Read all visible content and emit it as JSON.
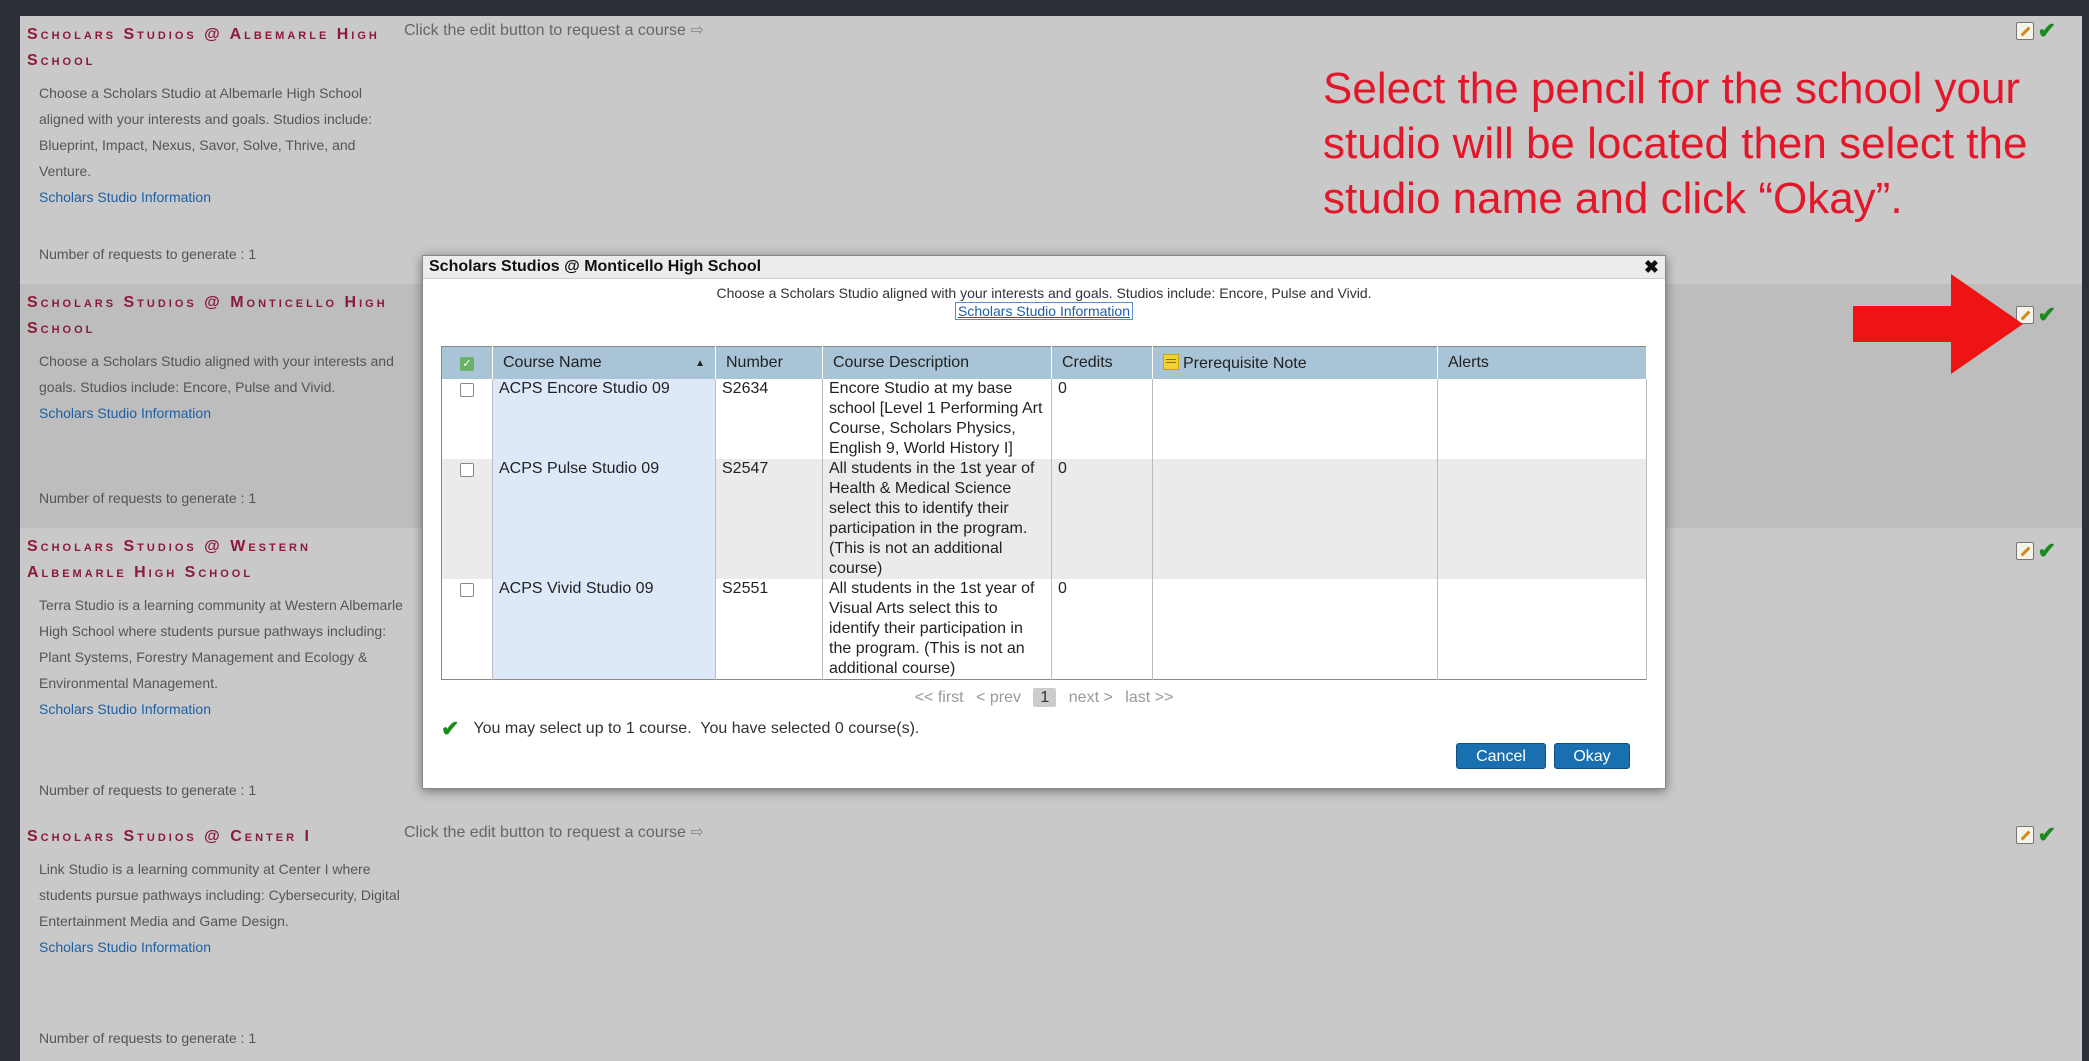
{
  "sections": [
    {
      "title": "Scholars Studios @ Albemarle High School",
      "description": "Choose a Scholars Studio at Albemarle High School aligned with your interests and goals. Studios include: Blueprint, Impact, Nexus, Savor, Solve, Thrive, and Venture.",
      "link": "Scholars Studio Information",
      "requests": "Number of requests to generate : 1",
      "edit_message": "Click the edit button to request a course"
    },
    {
      "title": "Scholars Studios @ Monticello High School",
      "description": "Choose a Scholars Studio aligned with your interests and goals. Studios include: Encore, Pulse and Vivid.",
      "link": "Scholars Studio Information",
      "requests": "Number of requests to generate : 1",
      "edit_message": ""
    },
    {
      "title": "Scholars Studios @ Western Albemarle High School",
      "description": "Terra Studio is a learning community at Western Albemarle High School where students pursue pathways including: Plant Systems, Forestry Management and Ecology & Environmental Management.",
      "link": "Scholars Studio Information",
      "requests": "Number of requests to generate : 1",
      "edit_message": ""
    },
    {
      "title": "Scholars Studios @ Center I",
      "description": "Link Studio is a learning community at Center I where students pursue pathways including: Cybersecurity, Digital Entertainment Media and Game Design.",
      "link": "Scholars Studio Information",
      "requests": "Number of requests to generate : 1",
      "edit_message": "Click the edit button to request a course"
    }
  ],
  "annotation": "Select the pencil for the school your studio will be located then select the studio name and click “Okay”.",
  "modal": {
    "title": "Scholars Studios @ Monticello High School",
    "close": "✖",
    "intro": "Choose a Scholars Studio aligned with your interests and goals. Studios include: Encore, Pulse and Vivid.",
    "info_link": "Scholars Studio Information",
    "columns": {
      "name": "Course Name",
      "number": "Number",
      "description": "Course Description",
      "credits": "Credits",
      "prereq": "Prerequisite Note",
      "alerts": "Alerts"
    },
    "rows": [
      {
        "name": "ACPS Encore Studio 09",
        "number": "S2634",
        "description": "Encore Studio at my base school [Level 1 Performing Art Course, Scholars Physics, English 9, World History I]",
        "credits": "0",
        "prereq": "",
        "alerts": ""
      },
      {
        "name": "ACPS Pulse Studio 09",
        "number": "S2547",
        "description": "All students in the 1st year of Health & Medical Science select this to identify their participation in the program. (This is not an additional course)",
        "credits": "0",
        "prereq": "",
        "alerts": ""
      },
      {
        "name": "ACPS Vivid Studio 09",
        "number": "S2551",
        "description": "All students in the 1st year of Visual Arts select this to identify their participation in the program. (This is not an additional course)",
        "credits": "0",
        "prereq": "",
        "alerts": ""
      }
    ],
    "pager": {
      "first": "<< first",
      "prev": "< prev",
      "current": "1",
      "next": "next >",
      "last": "last >>"
    },
    "select_message": "You may select up to 1 course.  You have selected 0 course(s).",
    "cancel": "Cancel",
    "okay": "Okay"
  },
  "colors": {
    "accent": "#1a6fb0",
    "title": "#8b1a3a",
    "annotation": "#e3172a",
    "check": "#1d8a1d"
  }
}
